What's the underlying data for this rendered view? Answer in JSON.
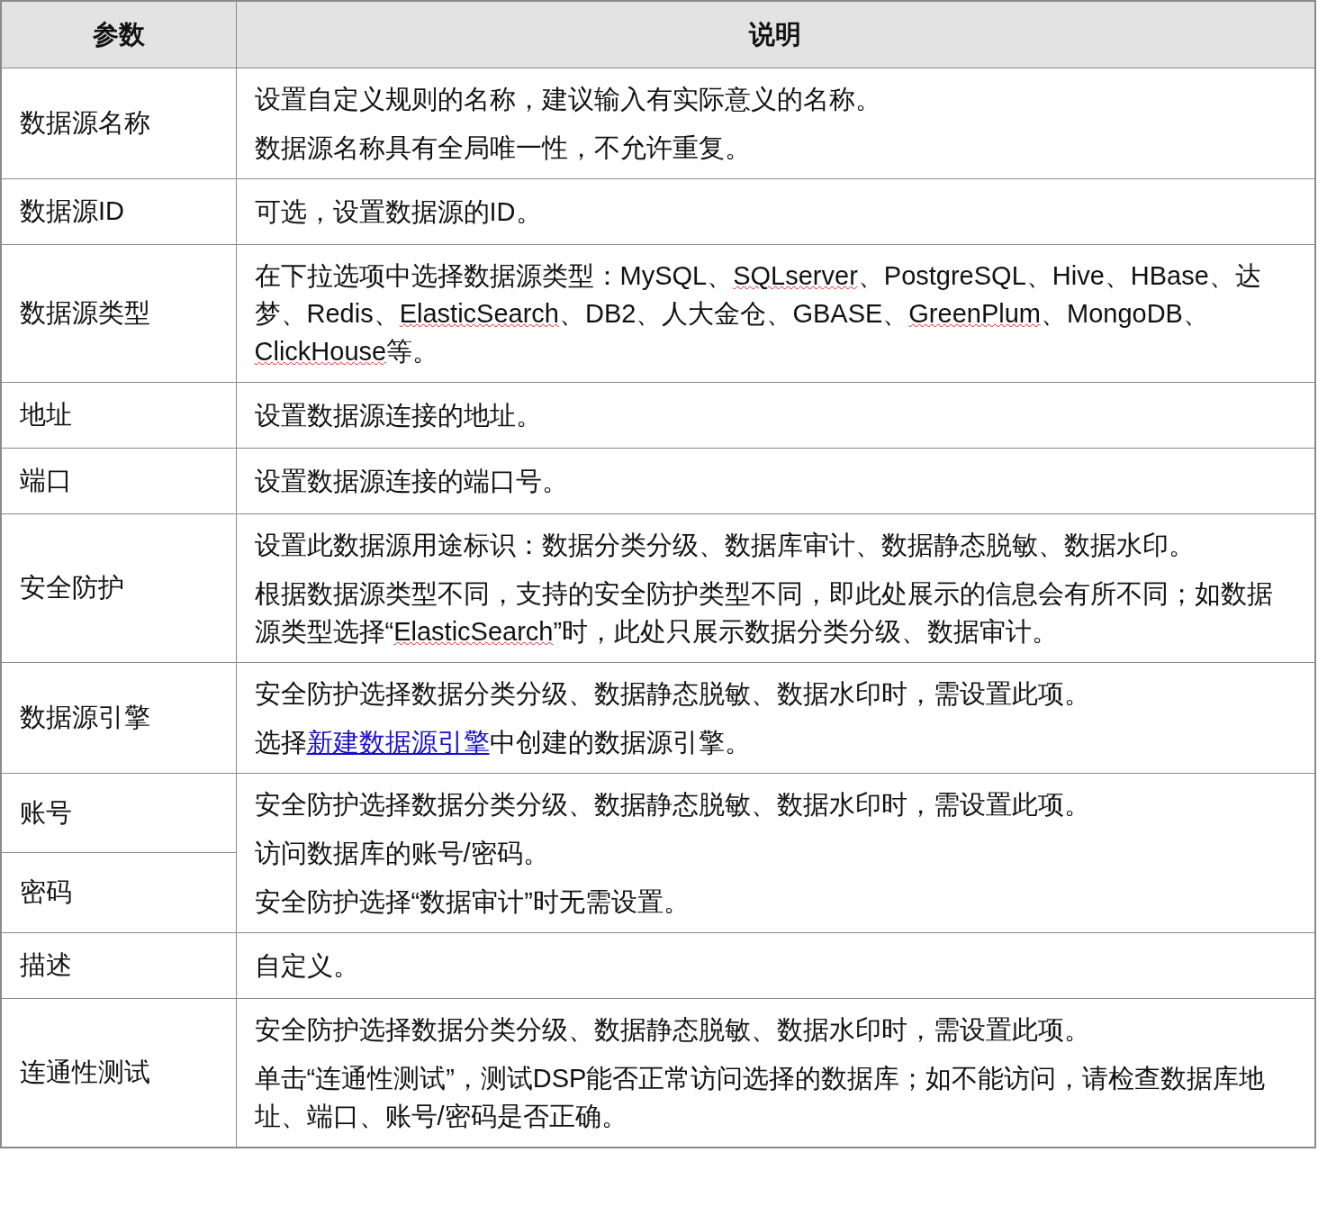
{
  "table": {
    "columns": [
      "参数",
      "说明"
    ],
    "rows": [
      {
        "params": [
          "数据源名称"
        ],
        "paragraphs": [
          [
            {
              "kind": "plain",
              "text": "设置自定义规则的名称，建议输入有实际意义的名称。"
            }
          ],
          [
            {
              "kind": "plain",
              "text": "数据源名称具有全局唯一性，不允许重复。"
            }
          ]
        ]
      },
      {
        "params": [
          "数据源ID"
        ],
        "paragraphs": [
          [
            {
              "kind": "plain",
              "text": "可选，设置数据源的ID。"
            }
          ]
        ]
      },
      {
        "params": [
          "数据源类型"
        ],
        "paragraphs": [
          [
            {
              "kind": "plain",
              "text": "在下拉选项中选择数据源类型：MySQL、"
            },
            {
              "kind": "misspelled",
              "text": "SQLserver"
            },
            {
              "kind": "plain",
              "text": "、PostgreSQL、Hive、HBase、达梦、Redis、"
            },
            {
              "kind": "misspelled",
              "text": "ElasticSearch"
            },
            {
              "kind": "plain",
              "text": "、DB2、人大金仓、GBASE、"
            },
            {
              "kind": "misspelled",
              "text": "GreenPlum"
            },
            {
              "kind": "plain",
              "text": "、MongoDB、"
            },
            {
              "kind": "misspelled",
              "text": "ClickHouse"
            },
            {
              "kind": "plain",
              "text": "等。"
            }
          ]
        ]
      },
      {
        "params": [
          "地址"
        ],
        "paragraphs": [
          [
            {
              "kind": "plain",
              "text": "设置数据源连接的地址。"
            }
          ]
        ]
      },
      {
        "params": [
          "端口"
        ],
        "paragraphs": [
          [
            {
              "kind": "plain",
              "text": "设置数据源连接的端口号。"
            }
          ]
        ]
      },
      {
        "params": [
          "安全防护"
        ],
        "paragraphs": [
          [
            {
              "kind": "plain",
              "text": "设置此数据源用途标识：数据分类分级、数据库审计、数据静态脱敏、数据水印。"
            }
          ],
          [
            {
              "kind": "plain",
              "text": "根据数据源类型不同，支持的安全防护类型不同，即此处展示的信息会有所不同；如数据源类型选择“"
            },
            {
              "kind": "misspelled",
              "text": "ElasticSearch"
            },
            {
              "kind": "plain",
              "text": "”时，此处只展示数据分类分级、数据审计。"
            }
          ]
        ]
      },
      {
        "params": [
          "数据源引擎"
        ],
        "paragraphs": [
          [
            {
              "kind": "plain",
              "text": "安全防护选择数据分类分级、数据静态脱敏、数据水印时，需设置此项。"
            }
          ],
          [
            {
              "kind": "plain",
              "text": "选择"
            },
            {
              "kind": "link",
              "text": "新建数据源引擎"
            },
            {
              "kind": "plain",
              "text": "中创建的数据源引擎。"
            }
          ]
        ]
      },
      {
        "params": [
          "账号",
          "密码"
        ],
        "paragraphs": [
          [
            {
              "kind": "plain",
              "text": "安全防护选择数据分类分级、数据静态脱敏、数据水印时，需设置此项。"
            }
          ],
          [
            {
              "kind": "plain",
              "text": "访问数据库的账号/密码。"
            }
          ],
          [
            {
              "kind": "plain",
              "text": "安全防护选择“数据审计”时无需设置。"
            }
          ]
        ]
      },
      {
        "params": [
          "描述"
        ],
        "paragraphs": [
          [
            {
              "kind": "plain",
              "text": "自定义。"
            }
          ]
        ]
      },
      {
        "params": [
          "连通性测试"
        ],
        "paragraphs": [
          [
            {
              "kind": "plain",
              "text": "安全防护选择数据分类分级、数据静态脱敏、数据水印时，需设置此项。"
            }
          ],
          [
            {
              "kind": "plain",
              "text": "单击“连通性测试”，测试DSP能否正常访问选择的数据库；如不能访问，请检查数据库地址、端口、账号/密码是否正确。"
            }
          ]
        ]
      }
    ]
  }
}
